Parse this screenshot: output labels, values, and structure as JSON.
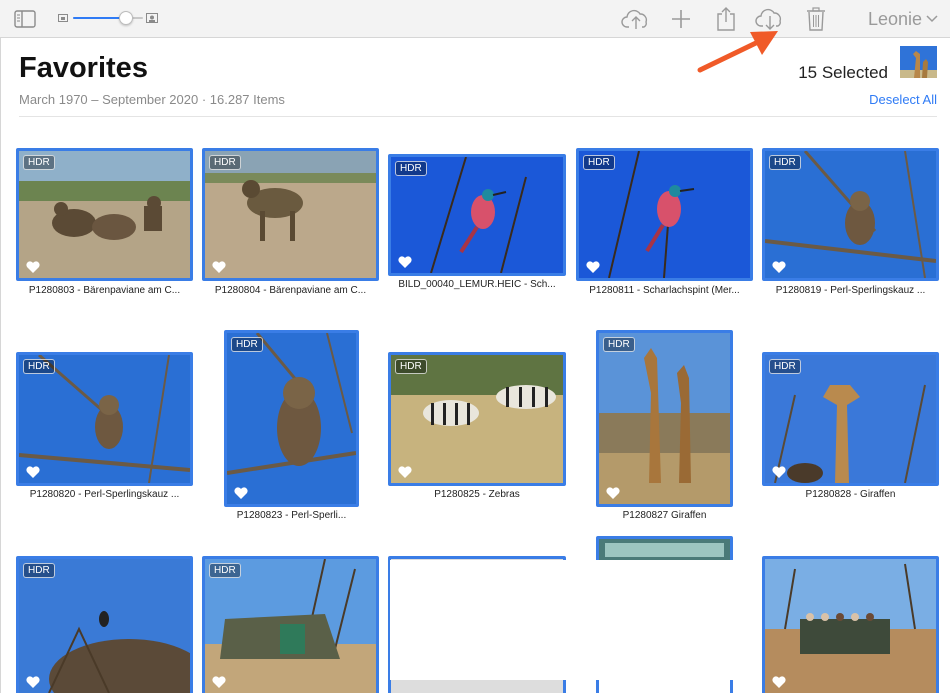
{
  "toolbar": {
    "user_name": "Leonie",
    "zoom_level": 0.75
  },
  "header": {
    "title": "Favorites",
    "subtitle": "March 1970 – September 2020  ·  16.287 Items",
    "selected": "15 Selected",
    "deselect_label": "Deselect All"
  },
  "colors": {
    "selection": "#3a7de6",
    "accent": "#2f7bf5",
    "annotation": "#f05a28"
  },
  "photos": [
    {
      "hdr": "HDR",
      "caption": "P1280803 - Bärenpaviane am C..."
    },
    {
      "hdr": "HDR",
      "caption": "P1280804 - Bärenpaviane am C..."
    },
    {
      "hdr": "HDR",
      "caption": "BILD_00040_LEMUR.HEIC - Sch..."
    },
    {
      "hdr": "HDR",
      "caption": "P1280811 - Scharlachspint (Mer..."
    },
    {
      "hdr": "HDR",
      "caption": "P1280819 - Perl-Sperlingskauz ..."
    },
    {
      "hdr": "HDR",
      "caption": "P1280820 - Perl-Sperlingskauz ..."
    },
    {
      "hdr": "HDR",
      "caption": "P1280823 - Perl-Sperli..."
    },
    {
      "hdr": "HDR",
      "caption": "P1280825 - Zebras"
    },
    {
      "hdr": "HDR",
      "caption": "P1280827 Giraffen"
    },
    {
      "hdr": "HDR",
      "caption": "P1280828 - Giraffen"
    },
    {
      "hdr": "HDR",
      "caption": ""
    },
    {
      "hdr": "HDR",
      "caption": ""
    },
    {
      "hdr": "",
      "caption": ""
    },
    {
      "hdr": "",
      "caption": ""
    },
    {
      "hdr": "",
      "caption": ""
    }
  ]
}
